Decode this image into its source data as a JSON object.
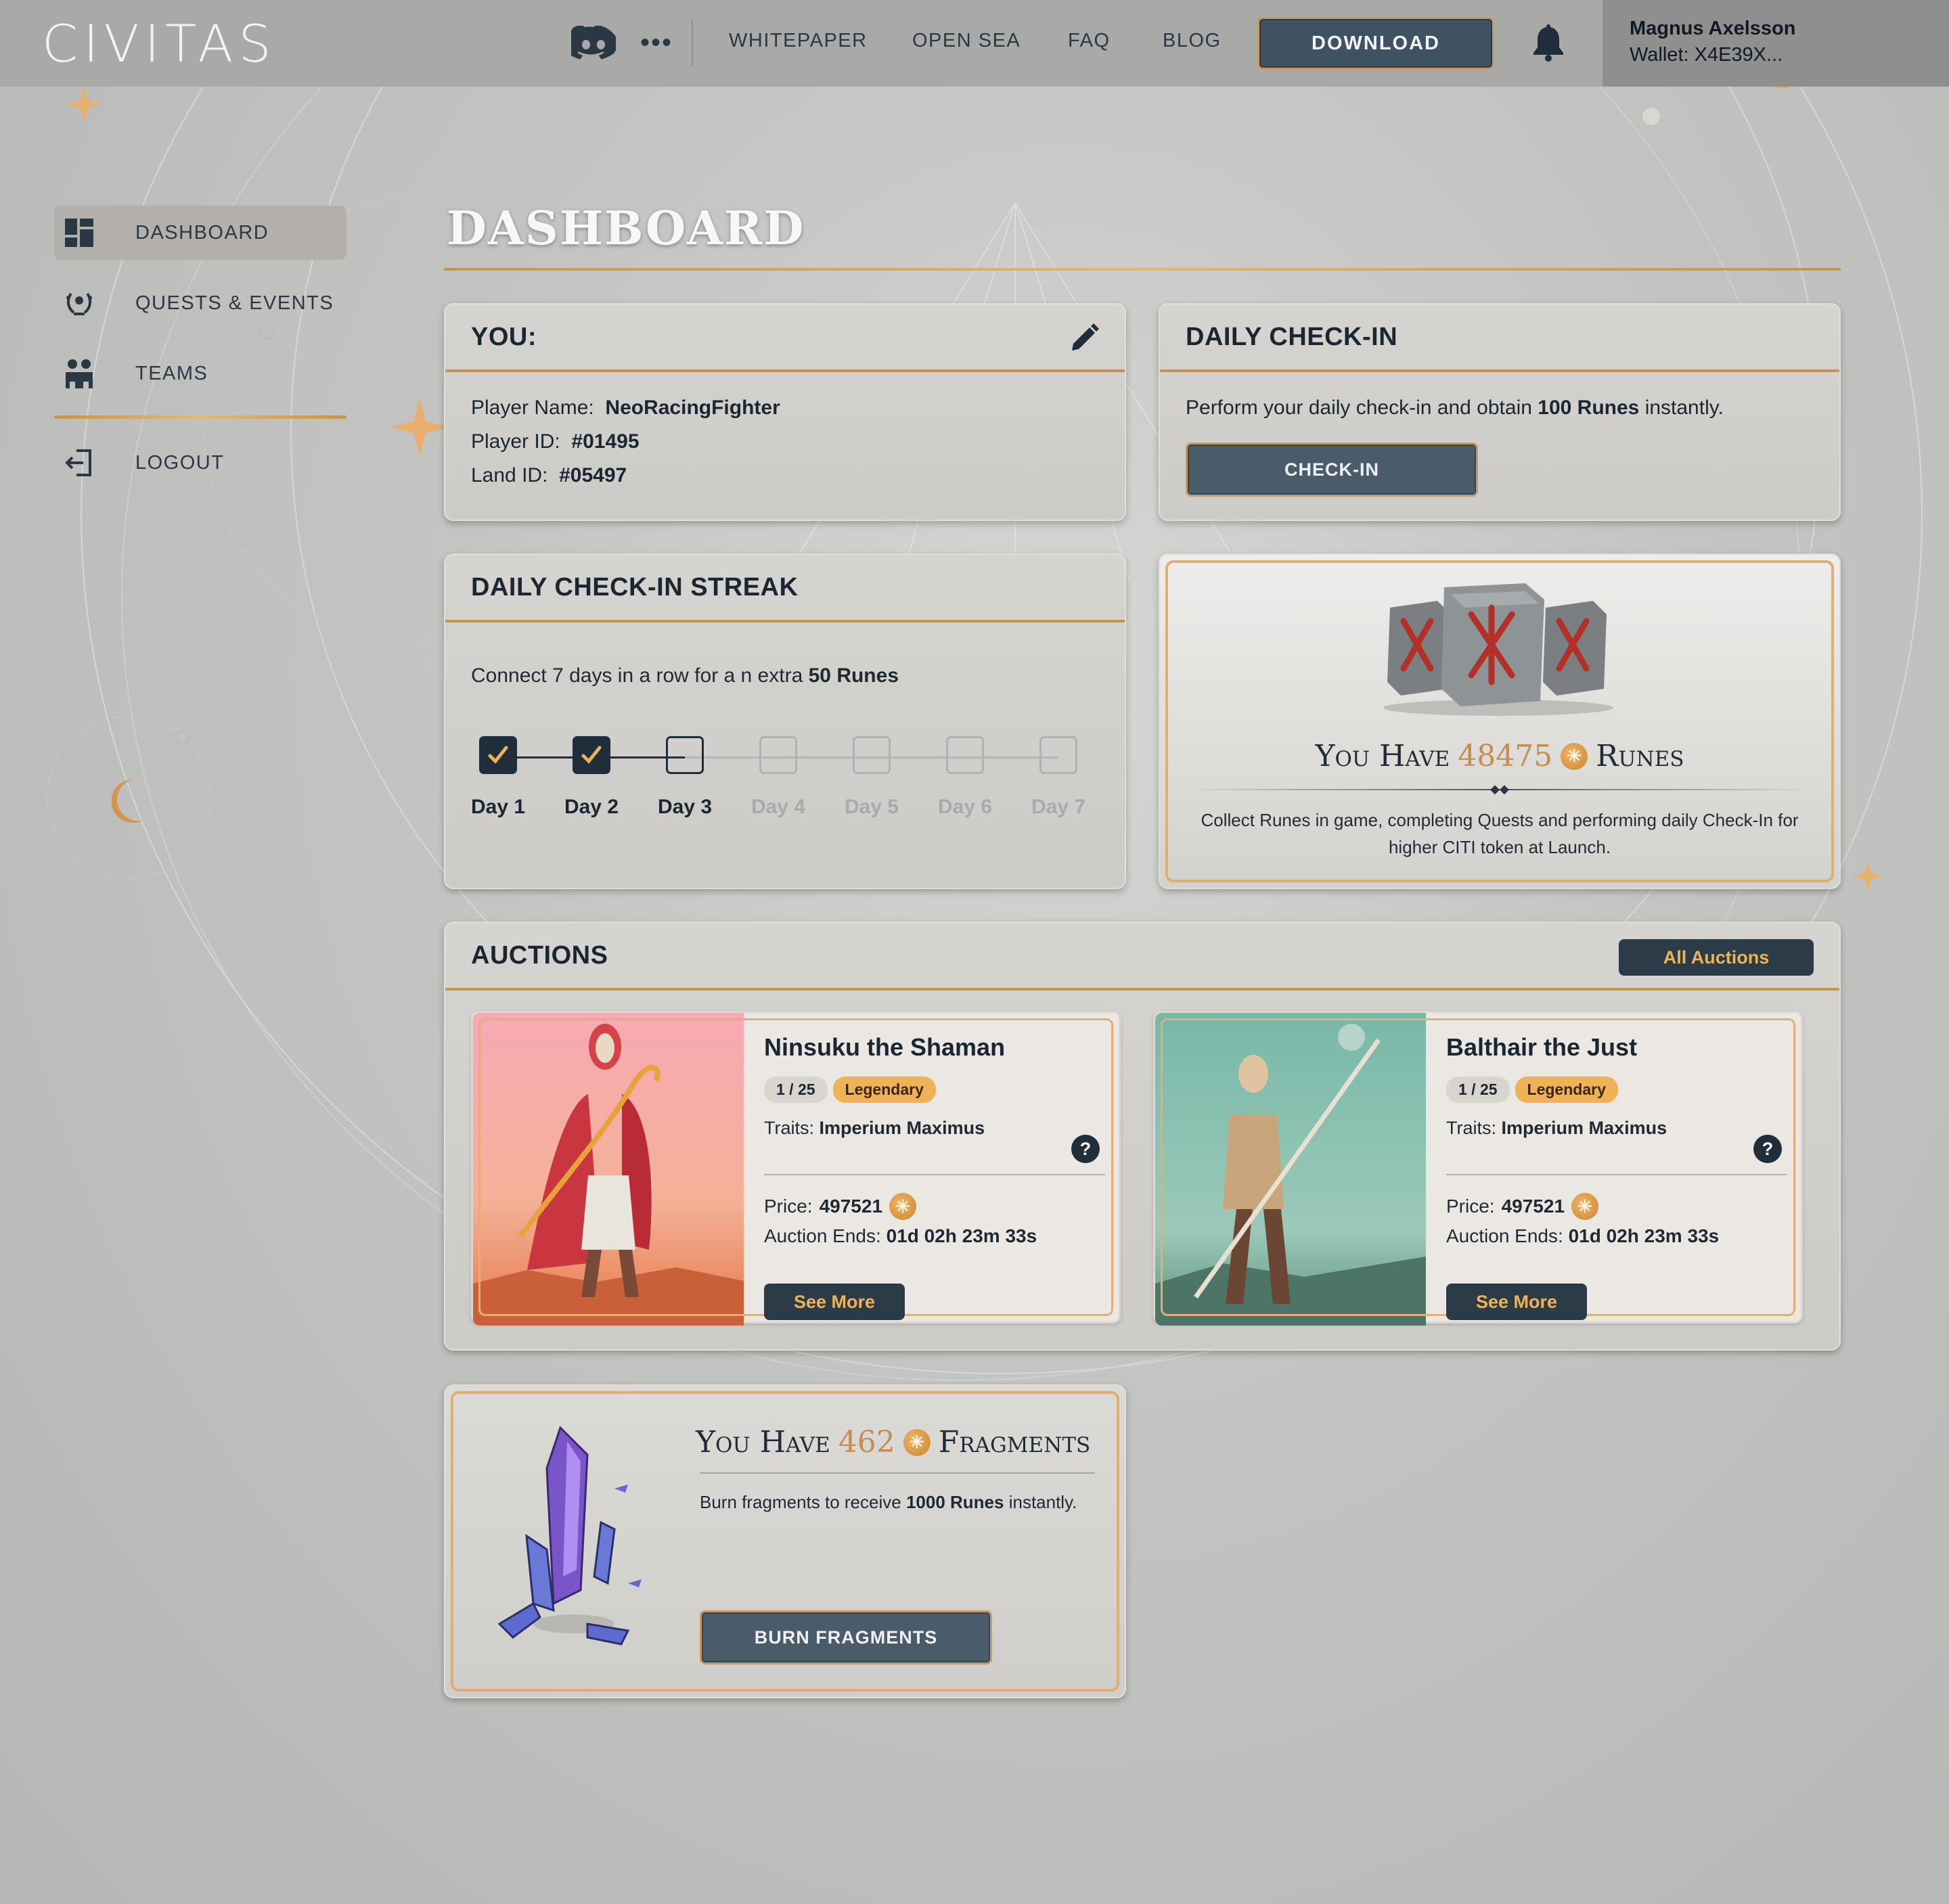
{
  "brand": {
    "logo_text": "CIVITAS"
  },
  "nav": {
    "links": [
      "WHITEPAPER",
      "OPEN SEA",
      "FAQ",
      "BLOG"
    ],
    "download": "DOWNLOAD",
    "more": "•••"
  },
  "user": {
    "name": "Magnus Axelsson",
    "wallet": "Wallet: X4E39X..."
  },
  "sidebar": {
    "items": [
      {
        "label": "DASHBOARD",
        "icon": "dashboard-grid-icon",
        "active": true
      },
      {
        "label": "QUESTS & EVENTS",
        "icon": "laurel-icon",
        "active": false
      },
      {
        "label": "TEAMS",
        "icon": "team-icon",
        "active": false
      }
    ],
    "logout": "LOGOUT"
  },
  "page": {
    "title": "DASHBOARD"
  },
  "you_card": {
    "title": "YOU:",
    "player_name_label": "Player Name:",
    "player_name": "NeoRacingFighter",
    "player_id_label": "Player ID:",
    "player_id": "#01495",
    "land_id_label": "Land ID:",
    "land_id": "#05497"
  },
  "checkin_card": {
    "title": "DAILY CHECK-IN",
    "text_before": "Perform your daily check-in and obtain",
    "text_bold": "100 Runes",
    "text_after": "instantly.",
    "button": "CHECK-IN"
  },
  "streak_card": {
    "title": "DAILY CHECK-IN STREAK",
    "text_before": "Connect 7 days in a row for a n extra",
    "text_bold": "50 Runes",
    "days": [
      {
        "label": "Day 1",
        "state": "done"
      },
      {
        "label": "Day 2",
        "state": "done"
      },
      {
        "label": "Day 3",
        "state": "current"
      },
      {
        "label": "Day 4",
        "state": "future"
      },
      {
        "label": "Day 5",
        "state": "future"
      },
      {
        "label": "Day 6",
        "state": "future"
      },
      {
        "label": "Day 7",
        "state": "future"
      }
    ]
  },
  "runes_card": {
    "you_have": "You Have",
    "amount": "48475",
    "unit": "Runes",
    "description": "Collect Runes in game, completing Quests and performing daily Check-In for higher CITI token at Launch."
  },
  "auctions": {
    "title": "AUCTIONS",
    "all_button": "All Auctions",
    "items": [
      {
        "name": "Ninsuku the Shaman",
        "edition": "1 / 25",
        "rarity": "Legendary",
        "traits_label": "Traits:",
        "traits": "Imperium Maximus",
        "price_label": "Price:",
        "price": "497521",
        "ends_label": "Auction Ends:",
        "ends": "01d 02h 23m 33s",
        "button": "See More"
      },
      {
        "name": "Balthair the Just",
        "edition": "1 / 25",
        "rarity": "Legendary",
        "traits_label": "Traits:",
        "traits": "Imperium Maximus",
        "price_label": "Price:",
        "price": "497521",
        "ends_label": "Auction Ends:",
        "ends": "01d 02h 23m 33s",
        "button": "See More"
      }
    ]
  },
  "fragments_card": {
    "you_have": "You Have",
    "amount": "462",
    "unit": "Fragments",
    "text_before": "Burn fragments to receive",
    "text_bold": "1000 Runes",
    "text_after": "instantly.",
    "button": "BURN FRAGMENTS"
  },
  "colors": {
    "accent_gold": "#c8924f",
    "button_dark": "#4a5b6a",
    "legendary": "#f0b257"
  }
}
